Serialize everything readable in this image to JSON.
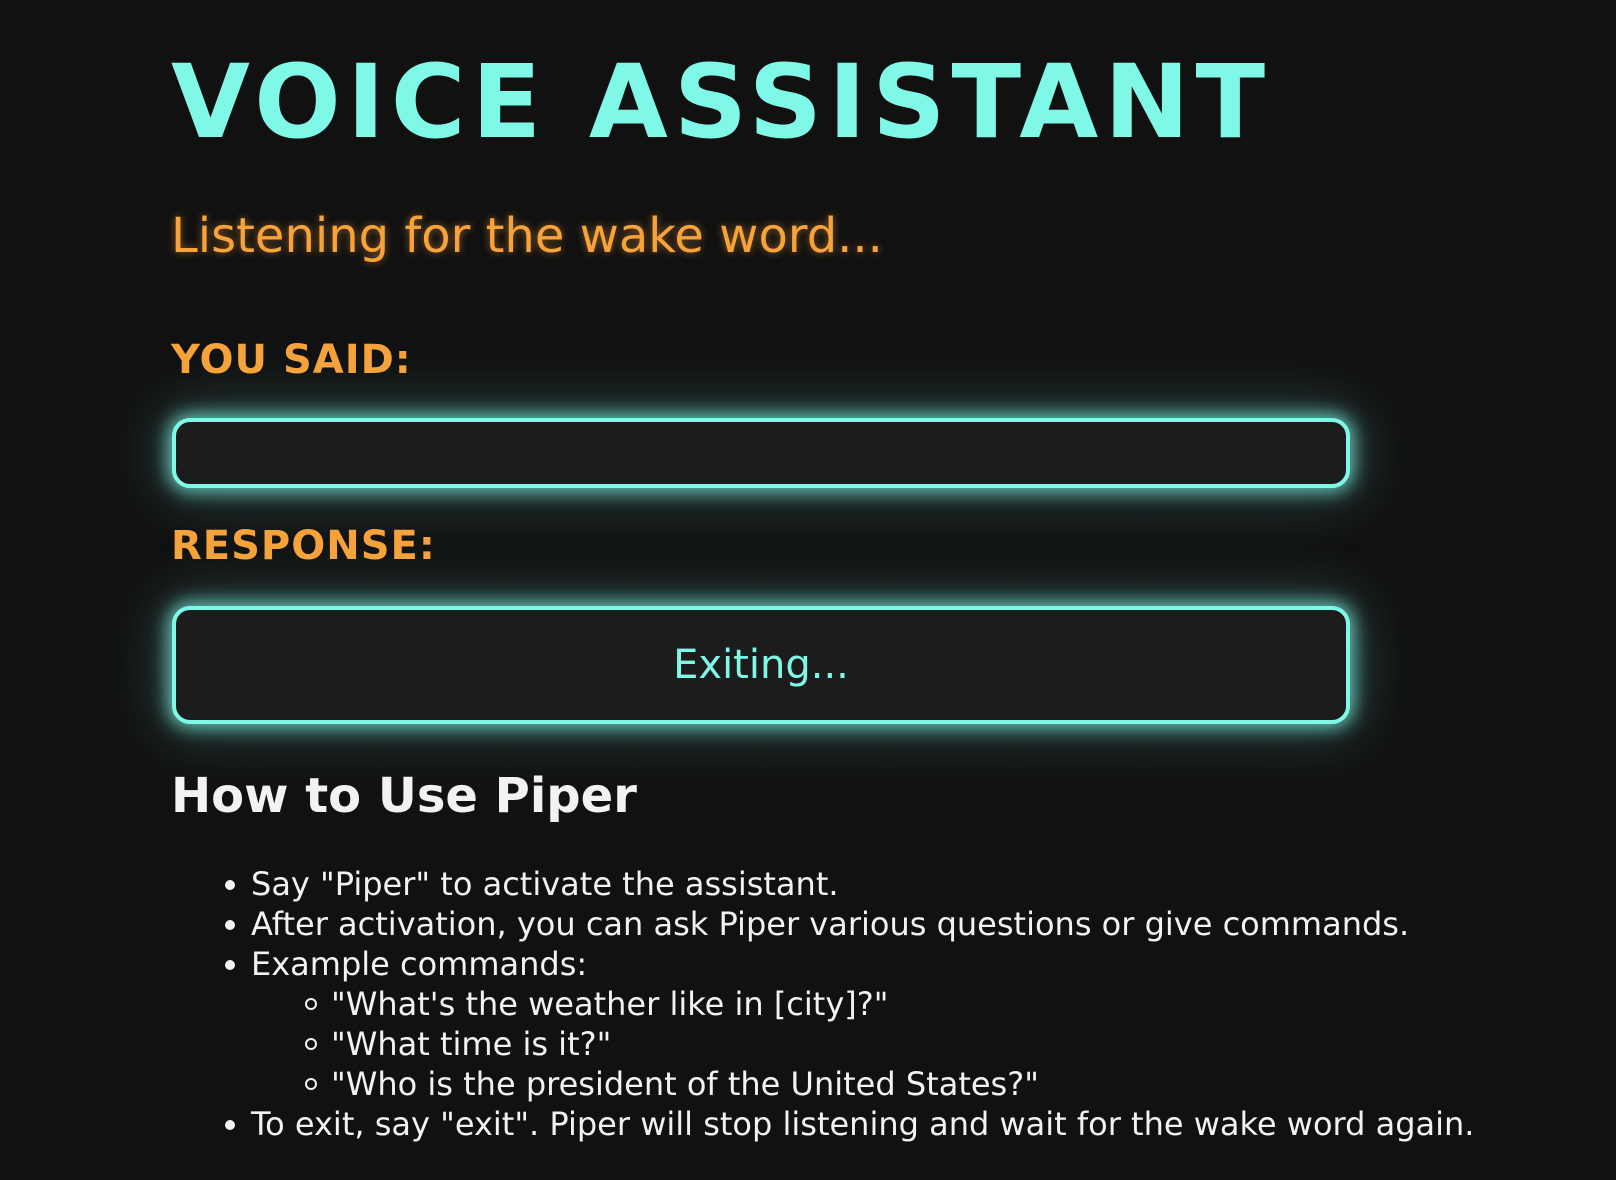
{
  "header": {
    "title": "VOICE ASSISTANT",
    "status": "Listening for the wake word..."
  },
  "you_said": {
    "label": "YOU SAID:",
    "value": ""
  },
  "response": {
    "label": "RESPONSE:",
    "value": "Exiting..."
  },
  "instructions": {
    "heading": "How to Use Piper",
    "items": [
      "Say \"Piper\" to activate the assistant.",
      "After activation, you can ask Piper various questions or give commands.",
      "Example commands:"
    ],
    "examples": [
      "\"What's the weather like in [city]?\"",
      "\"What time is it?\"",
      "\"Who is the president of the United States?\""
    ],
    "exit_item": "To exit, say \"exit\". Piper will stop listening and wait for the wake word again."
  },
  "colors": {
    "accent": "#7ff8e8",
    "label": "#f7a23a",
    "background": "#111111",
    "text": "#f2f2f2"
  }
}
